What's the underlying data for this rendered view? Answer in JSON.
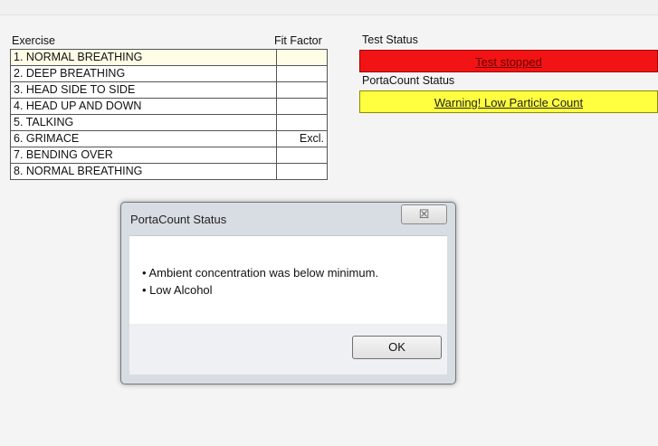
{
  "exercise_table": {
    "header_exercise": "Exercise",
    "header_fit_factor": "Fit Factor",
    "rows": [
      {
        "name": "1. NORMAL BREATHING",
        "fit_factor": ""
      },
      {
        "name": "2. DEEP BREATHING",
        "fit_factor": ""
      },
      {
        "name": "3. HEAD SIDE TO SIDE",
        "fit_factor": ""
      },
      {
        "name": "4. HEAD UP AND DOWN",
        "fit_factor": ""
      },
      {
        "name": "5. TALKING",
        "fit_factor": ""
      },
      {
        "name": "6. GRIMACE",
        "fit_factor": "Excl."
      },
      {
        "name": "7. BENDING OVER",
        "fit_factor": ""
      },
      {
        "name": "8. NORMAL BREATHING",
        "fit_factor": ""
      }
    ]
  },
  "test_status": {
    "label": "Test Status",
    "value": "Test stopped",
    "color": "#f21414"
  },
  "portacount_status": {
    "label": "PortaCount Status",
    "value": "Warning! Low Particle Count",
    "color": "#ffff40"
  },
  "dialog": {
    "title": "PortaCount Status",
    "close_glyph": "☒",
    "messages": [
      "• Ambient concentration was below minimum.",
      "• Low Alcohol"
    ],
    "ok_label": "OK"
  }
}
